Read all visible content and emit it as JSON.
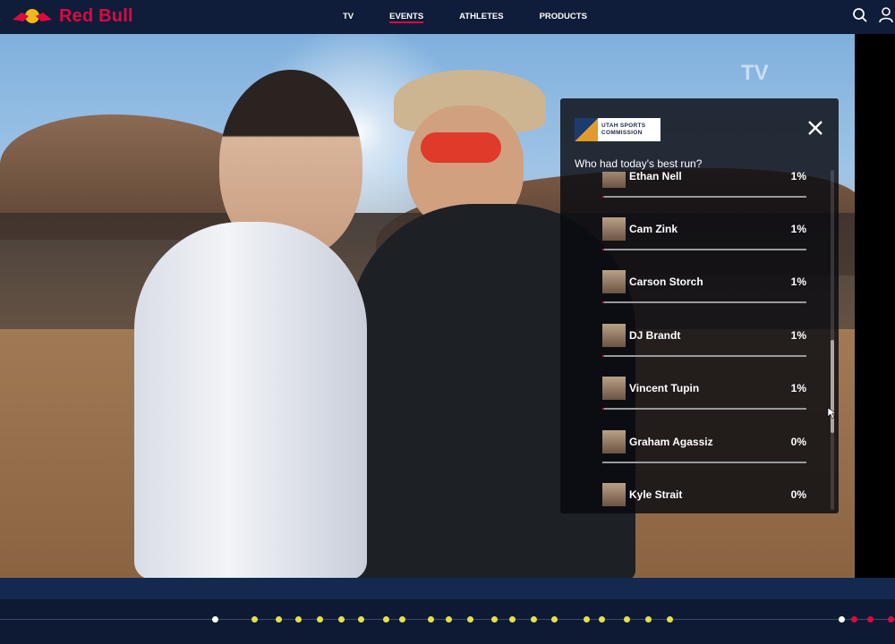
{
  "header": {
    "brand": "Red Bull",
    "nav": [
      "TV",
      "EVENTS",
      "ATHLETES",
      "PRODUCTS"
    ],
    "active_nav": "EVENTS",
    "brand_color": "#db0a40",
    "icons": [
      "search-icon",
      "user-icon"
    ]
  },
  "video": {
    "watermark": "TV"
  },
  "poll": {
    "sponsor_line1": "UTAH SPORTS",
    "sponsor_line2": "COMMISSION",
    "question": "Who had today's best run?",
    "options": [
      {
        "name": "Ethan Nell",
        "percent": "1%",
        "value": 1
      },
      {
        "name": "Cam Zink",
        "percent": "1%",
        "value": 1
      },
      {
        "name": "Carson Storch",
        "percent": "1%",
        "value": 1
      },
      {
        "name": "DJ Brandt",
        "percent": "1%",
        "value": 1
      },
      {
        "name": "Vincent Tupin",
        "percent": "1%",
        "value": 1
      },
      {
        "name": "Graham Agassiz",
        "percent": "0%",
        "value": 0
      },
      {
        "name": "Kyle Strait",
        "percent": "0%",
        "value": 0
      }
    ]
  },
  "timeline": {
    "marker_colors": {
      "current": "#ffffff",
      "highlight": "#e6e04a",
      "live": "#db0a40"
    }
  }
}
